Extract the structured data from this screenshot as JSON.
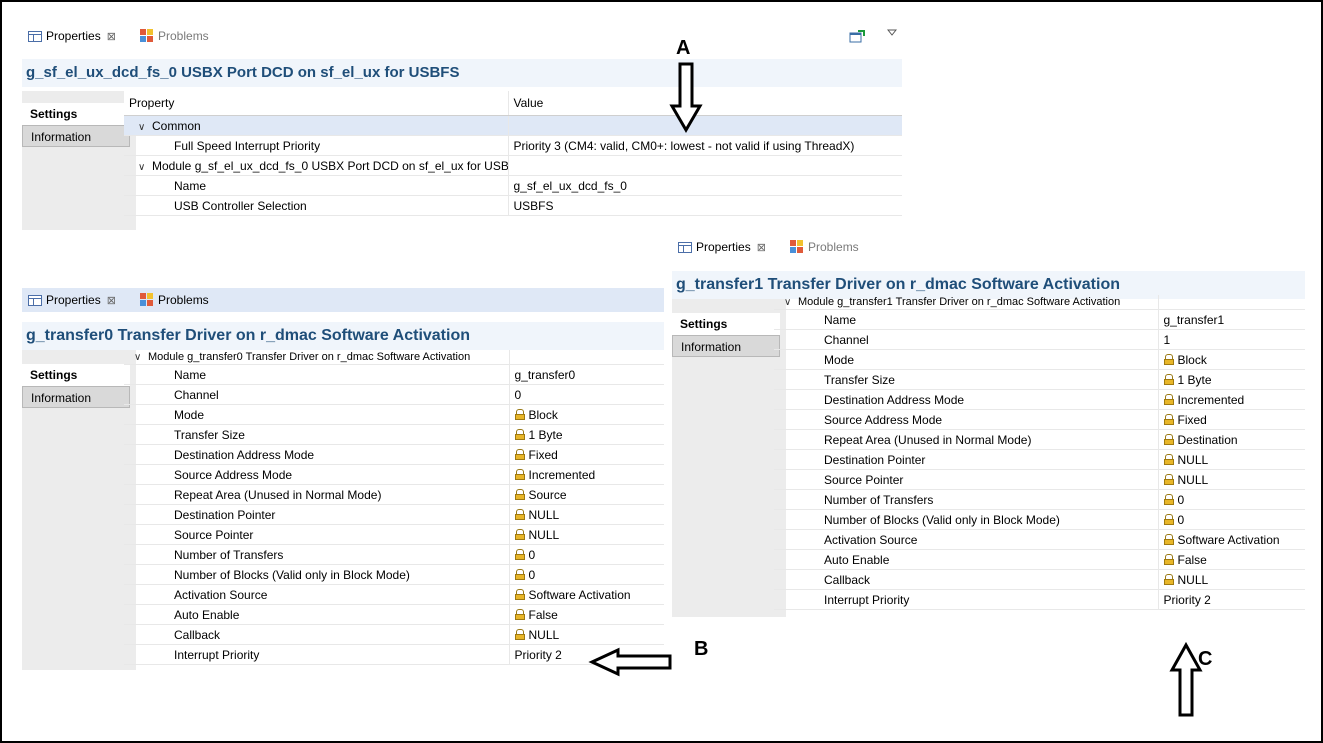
{
  "tabs": {
    "properties": "Properties",
    "close": "⊠",
    "problems": "Problems"
  },
  "sidebar": {
    "settings": "Settings",
    "information": "Information"
  },
  "panel_a": {
    "title": "g_sf_el_ux_dcd_fs_0 USBX Port DCD on sf_el_ux for USBFS",
    "header": {
      "property": "Property",
      "value": "Value"
    },
    "groups": [
      {
        "label": "Common",
        "rows": [
          {
            "name": "Full Speed Interrupt Priority",
            "value": "Priority 3 (CM4: valid, CM0+: lowest - not valid if using ThreadX)"
          }
        ]
      },
      {
        "label": "Module g_sf_el_ux_dcd_fs_0 USBX Port DCD on sf_el_ux for USBFS",
        "rows": [
          {
            "name": "Name",
            "value": "g_sf_el_ux_dcd_fs_0"
          },
          {
            "name": "USB Controller Selection",
            "value": "USBFS"
          }
        ]
      }
    ]
  },
  "panel_b": {
    "title": "g_transfer0 Transfer Driver on r_dmac Software Activation",
    "group": "Module g_transfer0 Transfer Driver on r_dmac Software Activation",
    "rows": [
      {
        "name": "Name",
        "value": "g_transfer0"
      },
      {
        "name": "Channel",
        "value": "0"
      },
      {
        "name": "Mode",
        "value": "Block"
      },
      {
        "name": "Transfer Size",
        "value": "1 Byte"
      },
      {
        "name": "Destination Address Mode",
        "value": "Fixed"
      },
      {
        "name": "Source Address Mode",
        "value": "Incremented"
      },
      {
        "name": "Repeat Area (Unused in Normal Mode)",
        "value": "Source"
      },
      {
        "name": "Destination Pointer",
        "value": "NULL"
      },
      {
        "name": "Source Pointer",
        "value": "NULL"
      },
      {
        "name": "Number of Transfers",
        "value": "0"
      },
      {
        "name": "Number of Blocks (Valid only in Block Mode)",
        "value": "0"
      },
      {
        "name": "Activation Source",
        "value": "Software Activation"
      },
      {
        "name": "Auto Enable",
        "value": "False"
      },
      {
        "name": "Callback",
        "value": "NULL"
      },
      {
        "name": "Interrupt Priority",
        "value": "Priority 2"
      }
    ]
  },
  "panel_c": {
    "title": "g_transfer1 Transfer Driver on r_dmac Software Activation",
    "group": "Module g_transfer1 Transfer Driver on r_dmac Software Activation",
    "rows": [
      {
        "name": "Name",
        "value": "g_transfer1"
      },
      {
        "name": "Channel",
        "value": "1"
      },
      {
        "name": "Mode",
        "value": "Block"
      },
      {
        "name": "Transfer Size",
        "value": "1 Byte"
      },
      {
        "name": "Destination Address Mode",
        "value": "Incremented"
      },
      {
        "name": "Source Address Mode",
        "value": "Fixed"
      },
      {
        "name": "Repeat Area (Unused in Normal Mode)",
        "value": "Destination"
      },
      {
        "name": "Destination Pointer",
        "value": "NULL"
      },
      {
        "name": "Source Pointer",
        "value": "NULL"
      },
      {
        "name": "Number of Transfers",
        "value": "0"
      },
      {
        "name": "Number of Blocks (Valid only in Block Mode)",
        "value": "0"
      },
      {
        "name": "Activation Source",
        "value": "Software Activation"
      },
      {
        "name": "Auto Enable",
        "value": "False"
      },
      {
        "name": "Callback",
        "value": "NULL"
      },
      {
        "name": "Interrupt Priority",
        "value": "Priority 2"
      }
    ]
  },
  "annotations": {
    "a": "A",
    "b": "B",
    "c": "C"
  }
}
